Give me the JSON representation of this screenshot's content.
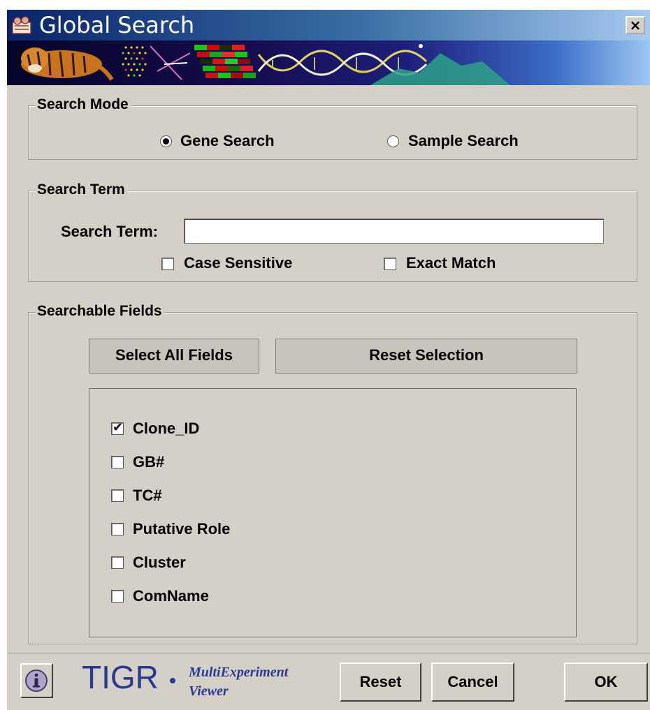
{
  "window": {
    "title": "Global Search",
    "close_label": "×"
  },
  "search_mode": {
    "legend": "Search Mode",
    "options": [
      {
        "label": "Gene Search",
        "selected": true
      },
      {
        "label": "Sample Search",
        "selected": false
      }
    ]
  },
  "search_term": {
    "legend": "Search Term",
    "field_label": "Search Term:",
    "value": "",
    "case_sensitive": {
      "label": "Case Sensitive",
      "checked": false
    },
    "exact_match": {
      "label": "Exact Match",
      "checked": false
    }
  },
  "searchable_fields": {
    "legend": "Searchable Fields",
    "select_all_label": "Select All Fields",
    "reset_selection_label": "Reset Selection",
    "fields": [
      {
        "label": "Clone_ID",
        "checked": true
      },
      {
        "label": "GB#",
        "checked": false
      },
      {
        "label": "TC#",
        "checked": false
      },
      {
        "label": "Putative Role",
        "checked": false
      },
      {
        "label": "Cluster",
        "checked": false
      },
      {
        "label": "ComName",
        "checked": false
      }
    ]
  },
  "footer": {
    "logo_text": "TIGR",
    "logo_sub_line1": "MultiExperiment",
    "logo_sub_line2": "Viewer",
    "reset_label": "Reset",
    "cancel_label": "Cancel",
    "ok_label": "OK",
    "info_icon": "info-icon"
  },
  "colors": {
    "title_bar_start": "#0a246a",
    "title_bar_end": "#a6caf0",
    "logo_blue": "#2b3a8f",
    "dialog_bg": "#d4d0c8"
  }
}
